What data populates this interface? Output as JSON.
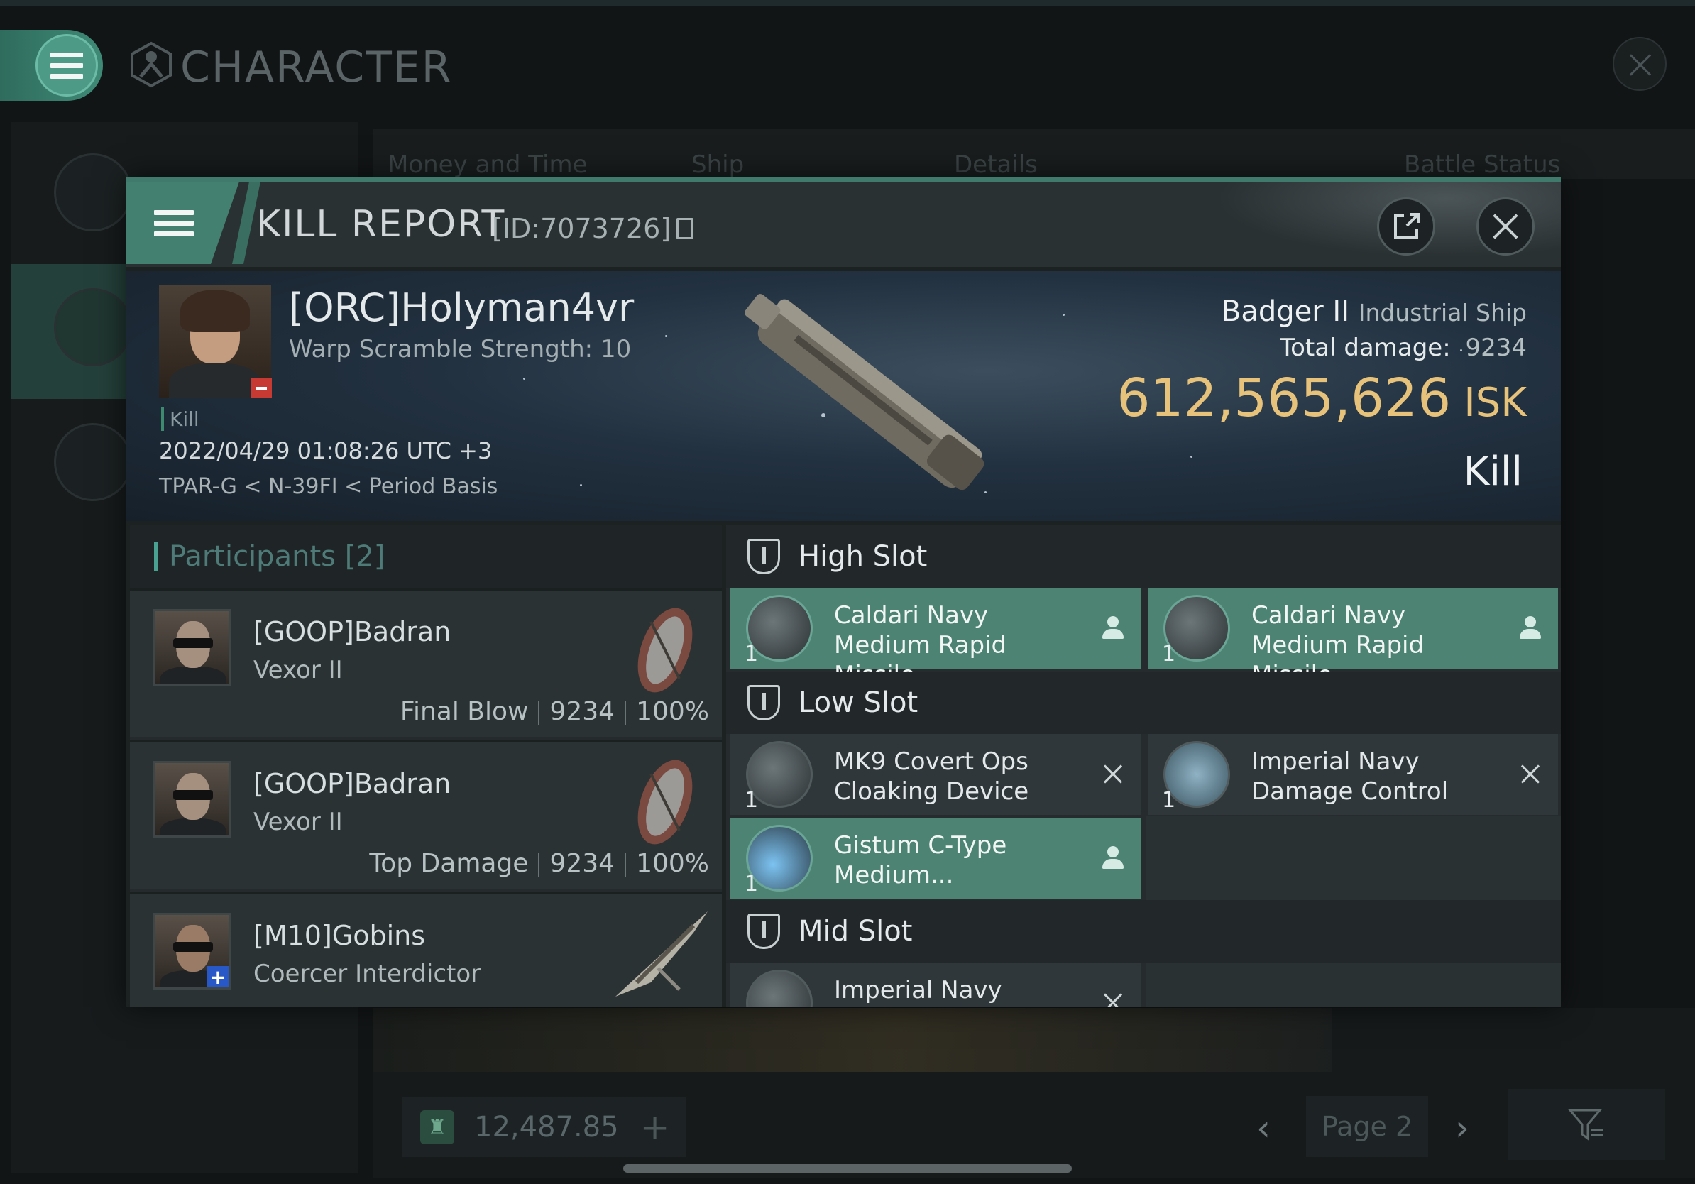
{
  "background": {
    "title": "CHARACTER",
    "tabs": [
      "Money and Time",
      "Ship",
      "Details",
      "Battle Status"
    ],
    "wallet_value": "12,487.85",
    "page_label": "Page 2"
  },
  "kill_report": {
    "title": "KILL REPORT",
    "id_label": "[ID:7073726]",
    "victim": {
      "name": "[ORC]Holyman4vr",
      "subtitle": "Warp Scramble Strength: 10",
      "tag": "Kill",
      "datetime": "2022/04/29 01:08:26 UTC +3",
      "location": "TPAR-G < N-39FI < Period Basis"
    },
    "ship": {
      "name": "Badger II",
      "class": "Industrial Ship",
      "total_damage_label": "Total damage:",
      "total_damage": "9234",
      "isk_value": "612,565,626",
      "isk_unit": "ISK",
      "result": "Kill"
    },
    "participants": {
      "label": "Participants",
      "count": "[2]",
      "rows": [
        {
          "name": "[GOOP]Badran",
          "ship": "Vexor II",
          "role": "Final Blow",
          "damage": "9234",
          "percent": "100%"
        },
        {
          "name": "[GOOP]Badran",
          "ship": "Vexor II",
          "role": "Top Damage",
          "damage": "9234",
          "percent": "100%"
        },
        {
          "name": "[M10]Gobins",
          "ship": "Coercer Interdictor",
          "role": "",
          "damage": "",
          "percent": ""
        }
      ]
    },
    "slots": {
      "high": {
        "title": "High Slot",
        "modules": [
          {
            "qty": "1",
            "name": "Caldari Navy Medium Rapid Missile...",
            "status": "dropped"
          },
          {
            "qty": "1",
            "name": "Caldari Navy Medium Rapid Missile...",
            "status": "dropped"
          }
        ]
      },
      "low": {
        "title": "Low Slot",
        "modules": [
          {
            "qty": "1",
            "name": "MK9 Covert Ops Cloaking Device",
            "status": "destroyed"
          },
          {
            "qty": "1",
            "name": "Imperial Navy Damage Control",
            "status": "destroyed"
          },
          {
            "qty": "1",
            "name": "Gistum C-Type Medium...",
            "status": "dropped"
          }
        ]
      },
      "mid": {
        "title": "Mid Slot",
        "modules": [
          {
            "qty": "1",
            "name": "Imperial Navy",
            "status": "destroyed"
          }
        ]
      }
    }
  }
}
